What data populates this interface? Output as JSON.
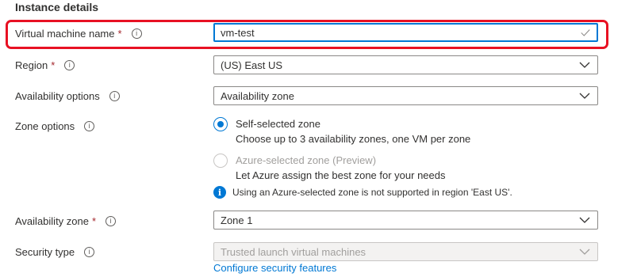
{
  "section_title": "Instance details",
  "vm_name": {
    "label": "Virtual machine name",
    "required": "*",
    "value": "vm-test"
  },
  "region": {
    "label": "Region",
    "required": "*",
    "value": "(US) East US"
  },
  "availability_options": {
    "label": "Availability options",
    "value": "Availability zone"
  },
  "zone_options": {
    "label": "Zone options",
    "options": [
      {
        "title": "Self-selected zone",
        "desc": "Choose up to 3 availability zones, one VM per zone",
        "selected": true,
        "enabled": true
      },
      {
        "title": "Azure-selected zone (Preview)",
        "desc": "Let Azure assign the best zone for your needs",
        "selected": false,
        "enabled": false
      }
    ],
    "notice": "Using an Azure-selected zone is not supported in region 'East US'."
  },
  "availability_zone": {
    "label": "Availability zone",
    "required": "*",
    "value": "Zone 1"
  },
  "security_type": {
    "label": "Security type",
    "value": "Trusted launch virtual machines",
    "link": "Configure security features"
  },
  "icons": {
    "info": "info-icon",
    "chevron": "chevron-down-icon",
    "check": "checkmark-icon"
  },
  "colors": {
    "accent": "#0078d4",
    "required": "#a4262c",
    "highlight": "#e81123"
  }
}
